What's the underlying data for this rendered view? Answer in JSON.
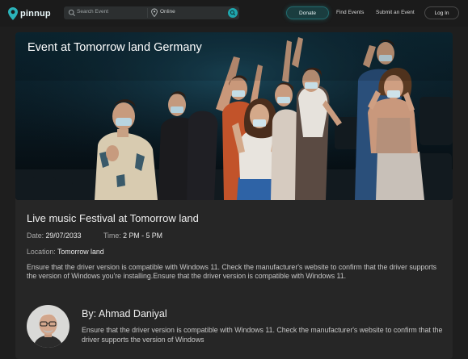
{
  "nav": {
    "brand": "pinnup",
    "search_placeholder": "Search Event",
    "location_value": "Online",
    "donate_label": "Donate",
    "links": [
      "Find Events",
      "Submit an Event"
    ],
    "login_label": "Log In",
    "accent_color": "#1fa6ad"
  },
  "hero": {
    "title": "Event at Tomorrow land Germany"
  },
  "event": {
    "title": "Live music Festival at Tomorrow land",
    "date_label": "Date:",
    "date_value": "29/07/2033",
    "time_label": "Time:",
    "time_value": "2 PM - 5 PM",
    "location_label": "Location:",
    "location_value": "Tomorrow land",
    "description": "Ensure that the driver version is compatible with Windows 11. Check the manufacturer's website to confirm that the driver supports the version of Windows you're installing.Ensure that the driver version is compatible with Windows 11."
  },
  "author": {
    "name": "By: Ahmad Daniyal",
    "description": "Ensure that the driver version is compatible with Windows 11. Check the manufacturer's website to confirm that the driver supports the version of Windows"
  }
}
